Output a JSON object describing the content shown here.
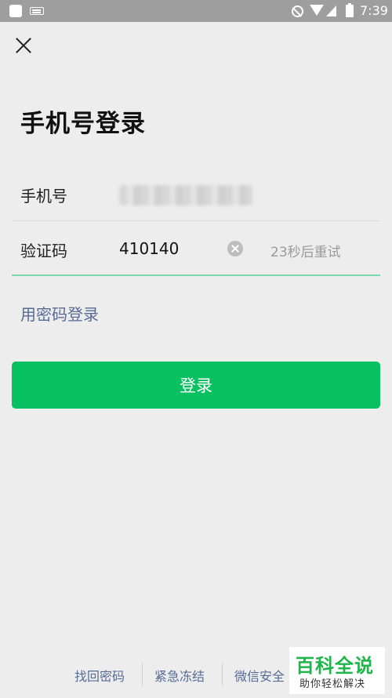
{
  "status_bar": {
    "time": "7:39",
    "icons": [
      "app-icon",
      "keyboard-icon",
      "do-not-disturb-icon",
      "wifi-icon",
      "signal-icon",
      "battery-icon"
    ]
  },
  "header": {
    "close_icon": "close-icon",
    "title": "手机号登录"
  },
  "form": {
    "phone": {
      "label": "手机号",
      "value_state": "blurred"
    },
    "code": {
      "label": "验证码",
      "value": "410140",
      "clear_icon": "clear-circle-icon",
      "retry_text": "23秒后重试"
    },
    "password_login_link": "用密码登录",
    "login_button": "登录"
  },
  "footer": {
    "links": [
      "找回密码",
      "紧急冻结",
      "微信安全"
    ]
  },
  "watermark": {
    "title": "百科全说",
    "subtitle": "助你轻松解决"
  },
  "colors": {
    "primary_green": "#07c160",
    "link_blue": "#576b95",
    "active_underline": "#7ad6ab",
    "background": "#ededed",
    "status_bar": "#9e9e9e"
  }
}
